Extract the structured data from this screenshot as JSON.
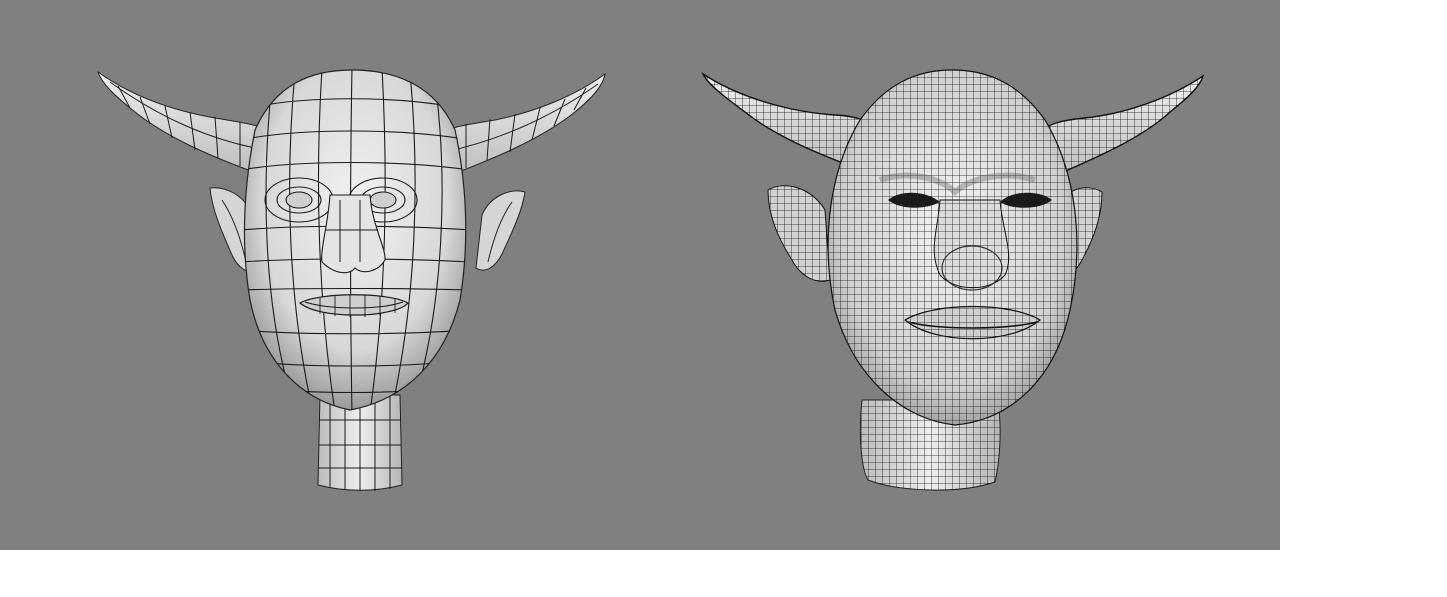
{
  "viewport": {
    "background_color": "#808080",
    "page_background": "#ffffff"
  },
  "models": [
    {
      "name": "low-poly-horned-head",
      "description_icon": "wireframe-head-low-poly",
      "surface_color": "#e6e6e6",
      "wire_color": "#1a1a1a",
      "grid_density": 18
    },
    {
      "name": "subdivided-horned-head",
      "description_icon": "wireframe-head-high-poly",
      "surface_color": "#e8e8e8",
      "wire_color": "#111111",
      "grid_density": 70
    }
  ]
}
